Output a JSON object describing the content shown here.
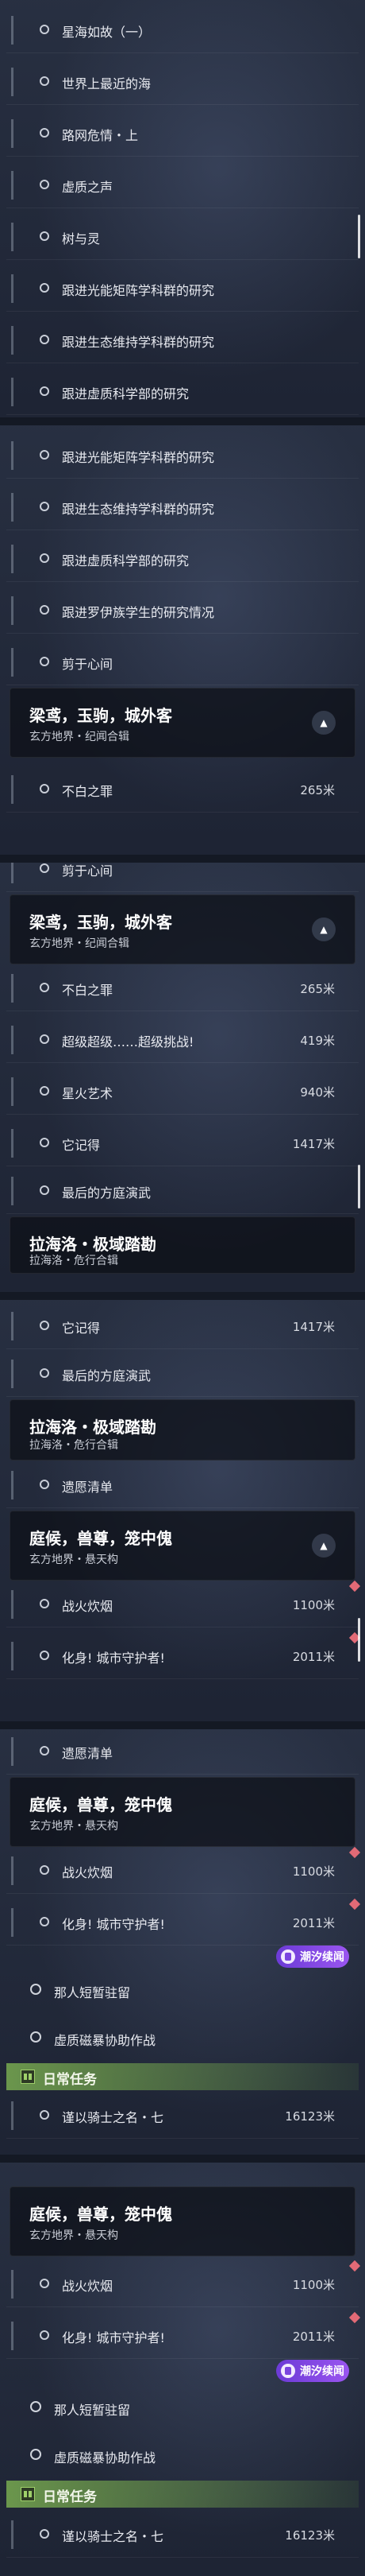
{
  "labels": {
    "xinghai": "星海如故（一）",
    "shijie": "世界上最近的海",
    "luwang": "路网危情・上",
    "xuhuo": "虚质之声",
    "shuyuling": "树与灵",
    "guangneng": "跟进光能矩阵学科群的研究",
    "shengtai": "跟进生态维持学科群的研究",
    "xuzhi": "跟进虚质科学部的研究",
    "luoyi": "跟进罗伊族学生的研究情况",
    "shouyu": "剪于心间",
    "liangyuan_title": "梁鸢，玉驹，城外客",
    "liangyuan_sub": "玄方地界・纪闻合辑",
    "buzhi": "不白之罪",
    "chaoji": "超级超级……超级挑战!",
    "xinghuo": "星火艺术",
    "tajide": "它记得",
    "zuihou": "最后的方庭演武",
    "lahailuo_title": "拉海洛・极域踏勘",
    "lahailuo_sub": "拉海洛・危行合辑",
    "yiyuan": "遗愿清单",
    "tinghou_title": "庭候，兽尊，笼中傀",
    "tinghou_sub": "玄方地界・悬天构",
    "zhanhuo": "战火炊烟",
    "huashen": "化身! 城市守护者!",
    "naren": "那人短暂驻留",
    "xuzhi_cixi": "虚质磁暴协助作战",
    "daily": "日常任务",
    "qiyi": "谨以骑士之名・七",
    "lixi": "潮汐续闻"
  },
  "distances": {
    "buzhi": "265米",
    "chaoji": "419米",
    "xinghuo": "940米",
    "tajide": "1417米",
    "zhanhuo": "1100米",
    "huashen": "2011米",
    "qiyi": "16123米"
  },
  "icons": {
    "collapse": "▲"
  }
}
